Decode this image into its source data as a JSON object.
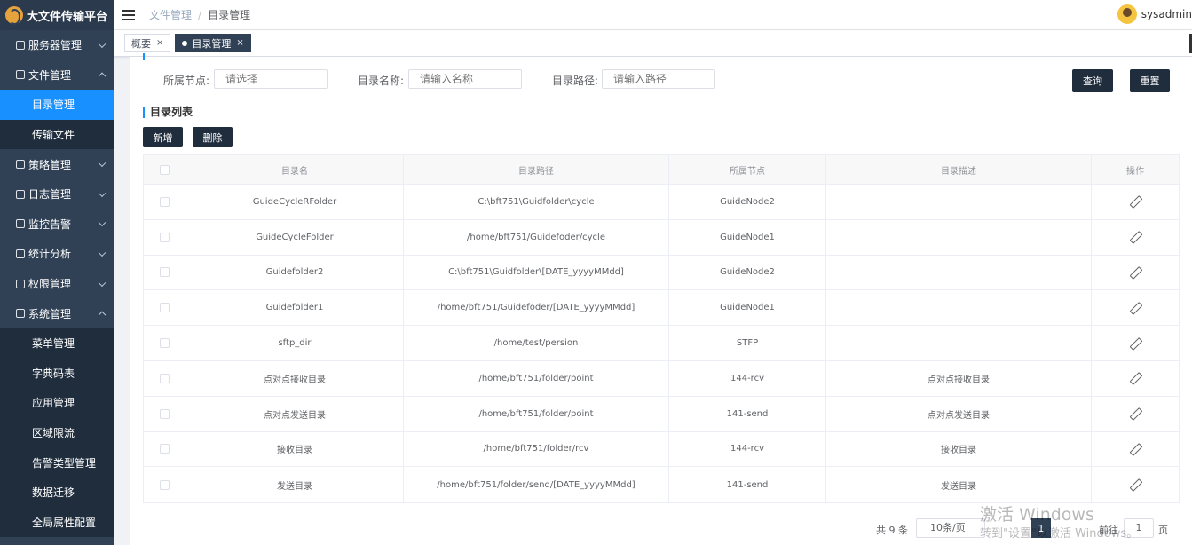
{
  "app": {
    "title": "大文件传输平台"
  },
  "sidebar": {
    "items": [
      {
        "label": "服务器管理",
        "icon": "cube-icon",
        "expanded": false
      },
      {
        "label": "文件管理",
        "icon": "layers-icon",
        "expanded": true,
        "children": [
          {
            "label": "目录管理",
            "active": true
          },
          {
            "label": "传输文件",
            "active": false
          }
        ]
      },
      {
        "label": "策略管理",
        "icon": "settings-icon",
        "expanded": false
      },
      {
        "label": "日志管理",
        "icon": "document-icon",
        "expanded": false
      },
      {
        "label": "监控告警",
        "icon": "monitor-icon",
        "expanded": false
      },
      {
        "label": "统计分析",
        "icon": "chart-icon",
        "expanded": false
      },
      {
        "label": "权限管理",
        "icon": "shield-icon",
        "expanded": false
      },
      {
        "label": "系统管理",
        "icon": "gear-icon",
        "expanded": true,
        "children": [
          {
            "label": "菜单管理"
          },
          {
            "label": "字典码表"
          },
          {
            "label": "应用管理"
          },
          {
            "label": "区域限流"
          },
          {
            "label": "告警类型管理"
          },
          {
            "label": "数据迁移"
          },
          {
            "label": "全局属性配置"
          }
        ]
      }
    ]
  },
  "header": {
    "breadcrumb": [
      "文件管理",
      "目录管理"
    ],
    "breadcrumb_sep": "/",
    "username": "sysadmin"
  },
  "tags": [
    {
      "label": "概要",
      "active": false,
      "close": "×"
    },
    {
      "label": "目录管理",
      "active": true,
      "close": "×"
    }
  ],
  "filters": {
    "node_label": "所属节点:",
    "node_placeholder": "请选择",
    "name_label": "目录名称:",
    "name_placeholder": "请输入名称",
    "path_label": "目录路径:",
    "path_placeholder": "请输入路径",
    "search_button": "查询",
    "reset_button": "重置"
  },
  "list": {
    "title": "目录列表",
    "add_button": "新增",
    "delete_button": "删除",
    "columns": [
      "目录名",
      "目录路径",
      "所属节点",
      "目录描述",
      "操作"
    ],
    "rows": [
      {
        "name": "GuideCycleRFolder",
        "path": "C:\\bft751\\Guidfolder\\cycle",
        "node": "GuideNode2",
        "desc": ""
      },
      {
        "name": "GuideCycleFolder",
        "path": "/home/bft751/Guidefoder/cycle",
        "node": "GuideNode1",
        "desc": ""
      },
      {
        "name": "Guidefolder2",
        "path": "C:\\bft751\\Guidfolder\\[DATE_yyyyMMdd]",
        "node": "GuideNode2",
        "desc": ""
      },
      {
        "name": "Guidefolder1",
        "path": "/home/bft751/Guidefoder/[DATE_yyyyMMdd]",
        "node": "GuideNode1",
        "desc": ""
      },
      {
        "name": "sftp_dir",
        "path": "/home/test/persion",
        "node": "STFP",
        "desc": ""
      },
      {
        "name": "点对点接收目录",
        "path": "/home/bft751/folder/point",
        "node": "144-rcv",
        "desc": "点对点接收目录"
      },
      {
        "name": "点对点发送目录",
        "path": "/home/bft751/folder/point",
        "node": "141-send",
        "desc": "点对点发送目录"
      },
      {
        "name": "接收目录",
        "path": "/home/bft751/folder/rcv",
        "node": "144-rcv",
        "desc": "接收目录"
      },
      {
        "name": "发送目录",
        "path": "/home/bft751/folder/send/[DATE_yyyyMMdd]",
        "node": "141-send",
        "desc": "发送目录"
      }
    ]
  },
  "pagination": {
    "total": "共 9 条",
    "page_size": "10条/页",
    "current_page": "1",
    "goto_label": "前往",
    "goto_value": "1",
    "page_suffix": "页"
  },
  "watermark": {
    "line1": "激活 Windows",
    "line2": "转到\"设置\"以激活 Windows。"
  }
}
